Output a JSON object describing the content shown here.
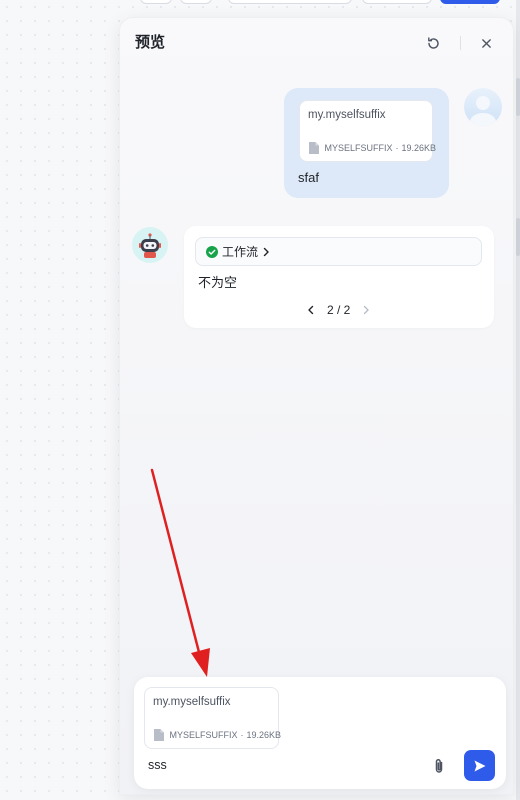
{
  "panel": {
    "title": "预览"
  },
  "header": {
    "refresh_icon": "refresh-icon",
    "close_icon": "close-icon"
  },
  "user_message": {
    "file": {
      "name": "my.myselfsuffix",
      "type": "MYSELFSUFFIX",
      "size": "19.26KB",
      "separator": "·"
    },
    "text": "sfaf"
  },
  "bot_message": {
    "workflow_label": "工作流",
    "text": "不为空",
    "pager": {
      "current_total": "2 / 2"
    }
  },
  "composer": {
    "file": {
      "name": "my.myselfsuffix",
      "type": "MYSELFSUFFIX",
      "size": "19.26KB",
      "separator": "·"
    },
    "input_value": "sss"
  },
  "colors": {
    "accent": "#2f5bea",
    "user_bubble": "#dde9f8",
    "success": "#17a34a",
    "annotation_arrow": "#e02020"
  }
}
